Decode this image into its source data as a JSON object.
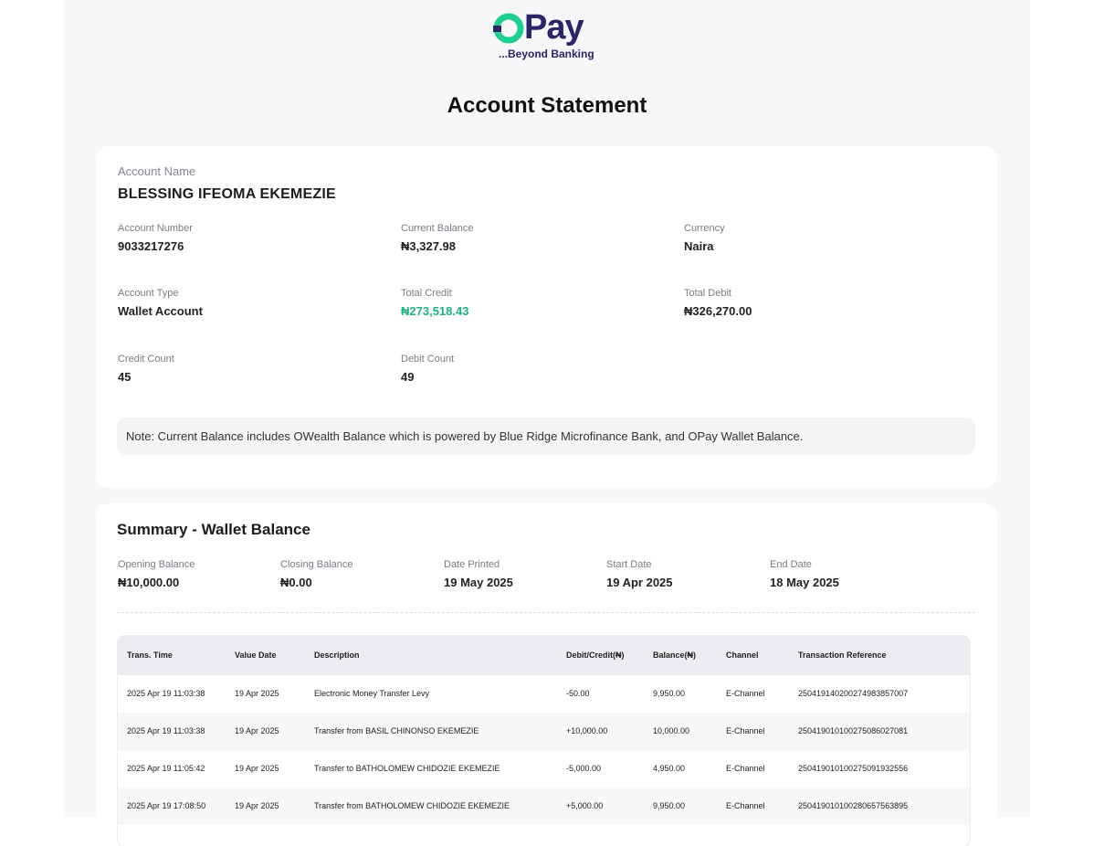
{
  "brand": {
    "name": "Pay",
    "tagline": "...Beyond Banking",
    "colors": {
      "primary": "#2a2468",
      "accent": "#1ecf8f"
    }
  },
  "page_title": "Account Statement",
  "account": {
    "name_label": "Account Name",
    "name": "BLESSING IFEOMA EKEMEZIE",
    "number_label": "Account Number",
    "number": "9033217276",
    "current_balance_label": "Current Balance",
    "current_balance": "₦3,327.98",
    "currency_label": "Currency",
    "currency": "Naira",
    "type_label": "Account Type",
    "type": "Wallet Account",
    "total_credit_label": "Total Credit",
    "total_credit": "₦273,518.43",
    "total_debit_label": "Total Debit",
    "total_debit": "₦326,270.00",
    "credit_count_label": "Credit Count",
    "credit_count": "45",
    "debit_count_label": "Debit Count",
    "debit_count": "49",
    "note": "Note: Current Balance includes OWealth Balance which is powered by Blue Ridge Microfinance Bank, and OPay Wallet Balance."
  },
  "summary": {
    "title": "Summary - Wallet Balance",
    "opening_label": "Opening Balance",
    "opening": "₦10,000.00",
    "closing_label": "Closing Balance",
    "closing": "₦0.00",
    "printed_label": "Date Printed",
    "printed": "19 May 2025",
    "start_label": "Start Date",
    "start": "19 Apr 2025",
    "end_label": "End Date",
    "end": "18 May 2025"
  },
  "table": {
    "headers": [
      "Trans. Time",
      "Value Date",
      "Description",
      "Debit/Credit(₦)",
      "Balance(₦)",
      "Channel",
      "Transaction Reference"
    ],
    "rows": [
      [
        "2025 Apr 19 11:03:38",
        "19 Apr 2025",
        "Electronic Money Transfer Levy",
        "-50.00",
        "9,950.00",
        "E-Channel",
        "250419140200274983857007"
      ],
      [
        "2025 Apr 19 11:03:38",
        "19 Apr 2025",
        "Transfer from BASIL CHINONSO EKEMEZIE",
        "+10,000.00",
        "10,000.00",
        "E-Channel",
        "250419010100275086027081"
      ],
      [
        "2025 Apr 19 11:05:42",
        "19 Apr 2025",
        "Transfer to BATHOLOMEW CHIDOZIE EKEMEZIE",
        "-5,000.00",
        "4,950.00",
        "E-Channel",
        "250419010100275091932556"
      ],
      [
        "2025 Apr 19 17:08:50",
        "19 Apr 2025",
        "Transfer from BATHOLOMEW CHIDOZIE EKEMEZIE",
        "+5,000.00",
        "9,950.00",
        "E-Channel",
        "250419010100280657563895"
      ]
    ],
    "credit_color": "#1fb37e"
  }
}
